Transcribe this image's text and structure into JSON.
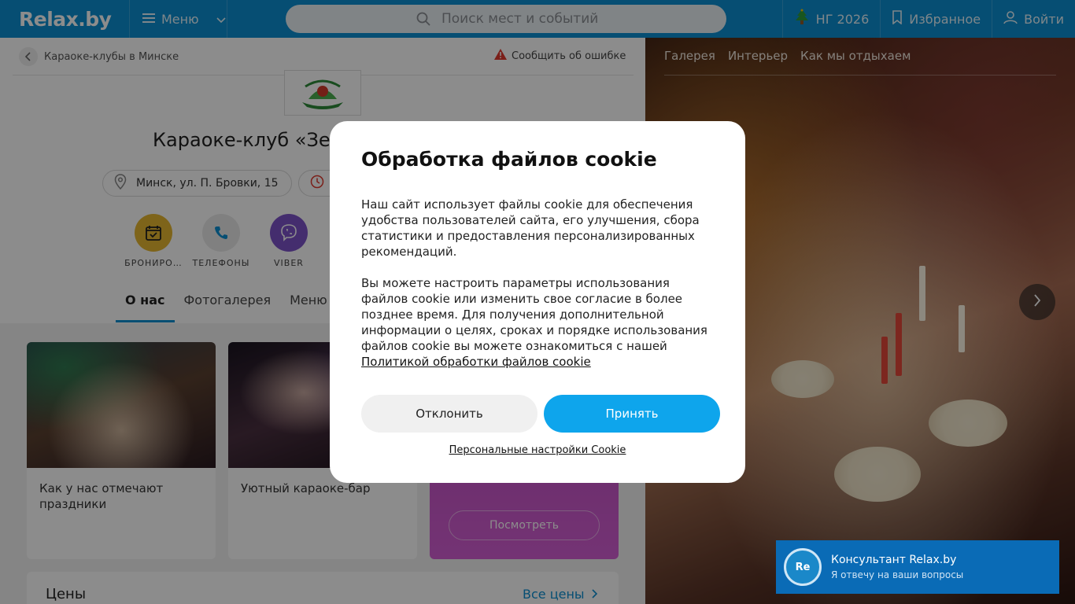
{
  "header": {
    "logo": "Relax.by",
    "menu_label": "Меню",
    "search_placeholder": "Поиск мест и событий",
    "ng_label": "НГ 2026",
    "favorites_label": "Избранное",
    "login_label": "Войти"
  },
  "breadcrumb": {
    "back_label": "Караоке-клубы в Минске",
    "report_label": "Сообщить об ошибке"
  },
  "place": {
    "title": "Караоке-клуб «Зе",
    "address": "Минск, ул. П. Бровки, 15",
    "actions": [
      {
        "label": "БРОНИРО…",
        "icon": "calendar-check-icon",
        "color": "#e5b731"
      },
      {
        "label": "ТЕЛЕФОНЫ",
        "icon": "phone-icon",
        "color": "#e9e9e9"
      },
      {
        "label": "VIBER",
        "icon": "viber-icon",
        "color": "#7d52c9"
      }
    ],
    "tabs": [
      "О нас",
      "Фотогалерея",
      "Меню и"
    ]
  },
  "features": [
    {
      "caption": "Как у нас отмечают праздники"
    },
    {
      "caption": "Уютный караоке-бар"
    },
    {
      "button": "Посмотреть"
    }
  ],
  "prices": {
    "title": "Цены",
    "link": "Все цены"
  },
  "gallery": {
    "tabs": [
      "Галерея",
      "Интерьер",
      "Как мы отдыхаем"
    ]
  },
  "consultant": {
    "avatar": "Re",
    "title": "Консультант Relax.by",
    "subtitle": "Я отвечу на ваши вопросы"
  },
  "cookie": {
    "title": "Обработка файлов cookie",
    "text1": "Наш сайт использует файлы cookie для обеспечения удобства пользователей сайта, его улучшения, сбора статистики и предоставления персонализированных рекомендаций.",
    "text2": "Вы можете настроить параметры использования файлов cookie или изменить свое согласие в более позднее время. Для получения дополнительной информации о целях, сроках и порядке использования файлов cookie вы можете ознакомиться с нашей",
    "policy_link": "Политикой обработки файлов cookie",
    "decline": "Отклонить",
    "accept": "Принять",
    "personal": "Персональные настройки Cookie"
  },
  "colors": {
    "brand": "#0b8fd1",
    "accept": "#0ea5ec",
    "consultant": "#0a6bb6"
  }
}
